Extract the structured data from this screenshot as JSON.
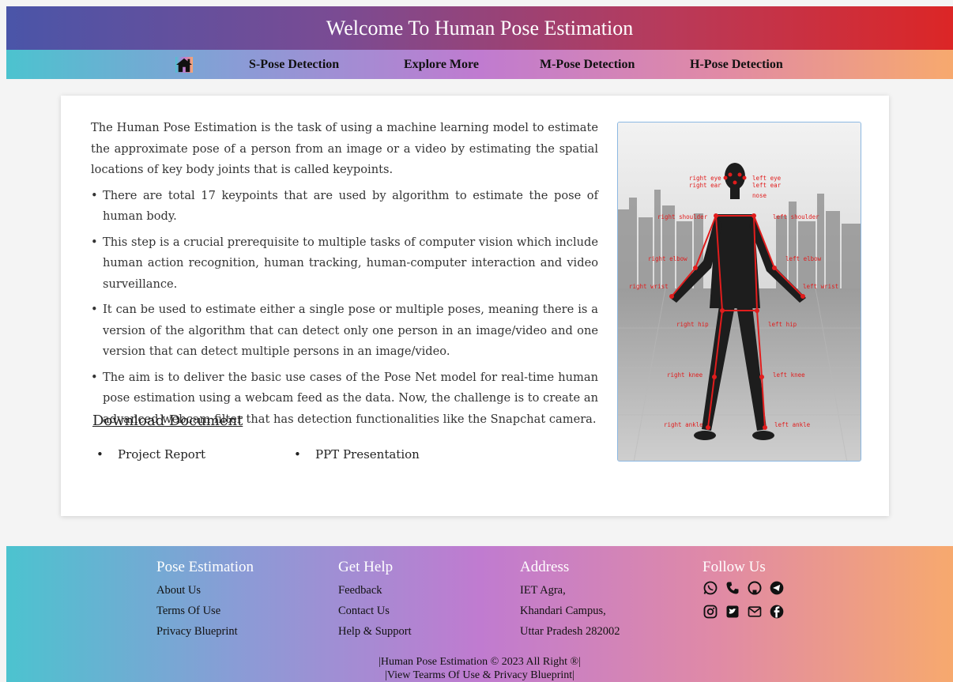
{
  "header": {
    "title": "Welcome To Human Pose Estimation"
  },
  "nav": {
    "items": [
      "S-Pose Detection",
      "Explore More",
      "M-Pose Detection",
      "H-Pose Detection"
    ]
  },
  "main": {
    "intro": "The Human Pose Estimation is the task of using a machine learning model to estimate the approximate pose of a person from an image or a video by estimating the spatial locations of key body joints that is called keypoints.",
    "bullets": [
      "There are total 17 keypoints that are used by algorithm to estimate the pose of human body.",
      "This step is a crucial prerequisite to multiple tasks of computer vision which include human action recognition, human tracking, human-computer interaction and video surveillance.",
      "It can be used to estimate either a single pose or multiple poses, meaning there is a version of the algorithm that can detect only one person in an image/video and one version that can detect multiple persons in an image/video.",
      "The aim is to deliver the basic use cases of the Pose Net model for real-time human pose estimation using a webcam feed as the data. Now, the challenge is to create an advanced webcam filter that has detection functionalities like the Snapchat camera."
    ],
    "download_title": "Download Document",
    "docs": [
      "Project Report",
      "PPT Presentation"
    ],
    "keypoint_labels": {
      "right_eye": "right eye",
      "left_eye": "left eye",
      "right_ear": "right ear",
      "left_ear": "left ear",
      "nose": "nose",
      "right_shoulder": "right shoulder",
      "left_shoulder": "left shoulder",
      "right_elbow": "right elbow",
      "left_elbow": "left elbow",
      "right_wrist": "right wrist",
      "left_wrist": "left wrist",
      "right_hip": "right hip",
      "left_hip": "left hip",
      "right_knee": "right knee",
      "left_knee": "left knee",
      "right_ankle": "right ankle",
      "left_ankle": "left ankle"
    }
  },
  "footer": {
    "col1": {
      "title": "Pose Estimation",
      "items": [
        "About Us",
        "Terms Of Use",
        "Privacy Blueprint"
      ]
    },
    "col2": {
      "title": "Get Help",
      "items": [
        "Feedback",
        "Contact Us",
        "Help & Support"
      ]
    },
    "col3": {
      "title": "Address",
      "items": [
        "IET Agra,",
        "Khandari Campus,",
        "Uttar Pradesh 282002"
      ]
    },
    "col4": {
      "title": "Follow Us"
    },
    "copyright1": "|Human Pose Estimation © 2023 All Right ®|",
    "copyright2": "|View Tearms Of Use & Privacy Blueprint|"
  },
  "colors": {
    "keypoint": "#e11d1d",
    "header_end": "#dc2626"
  }
}
